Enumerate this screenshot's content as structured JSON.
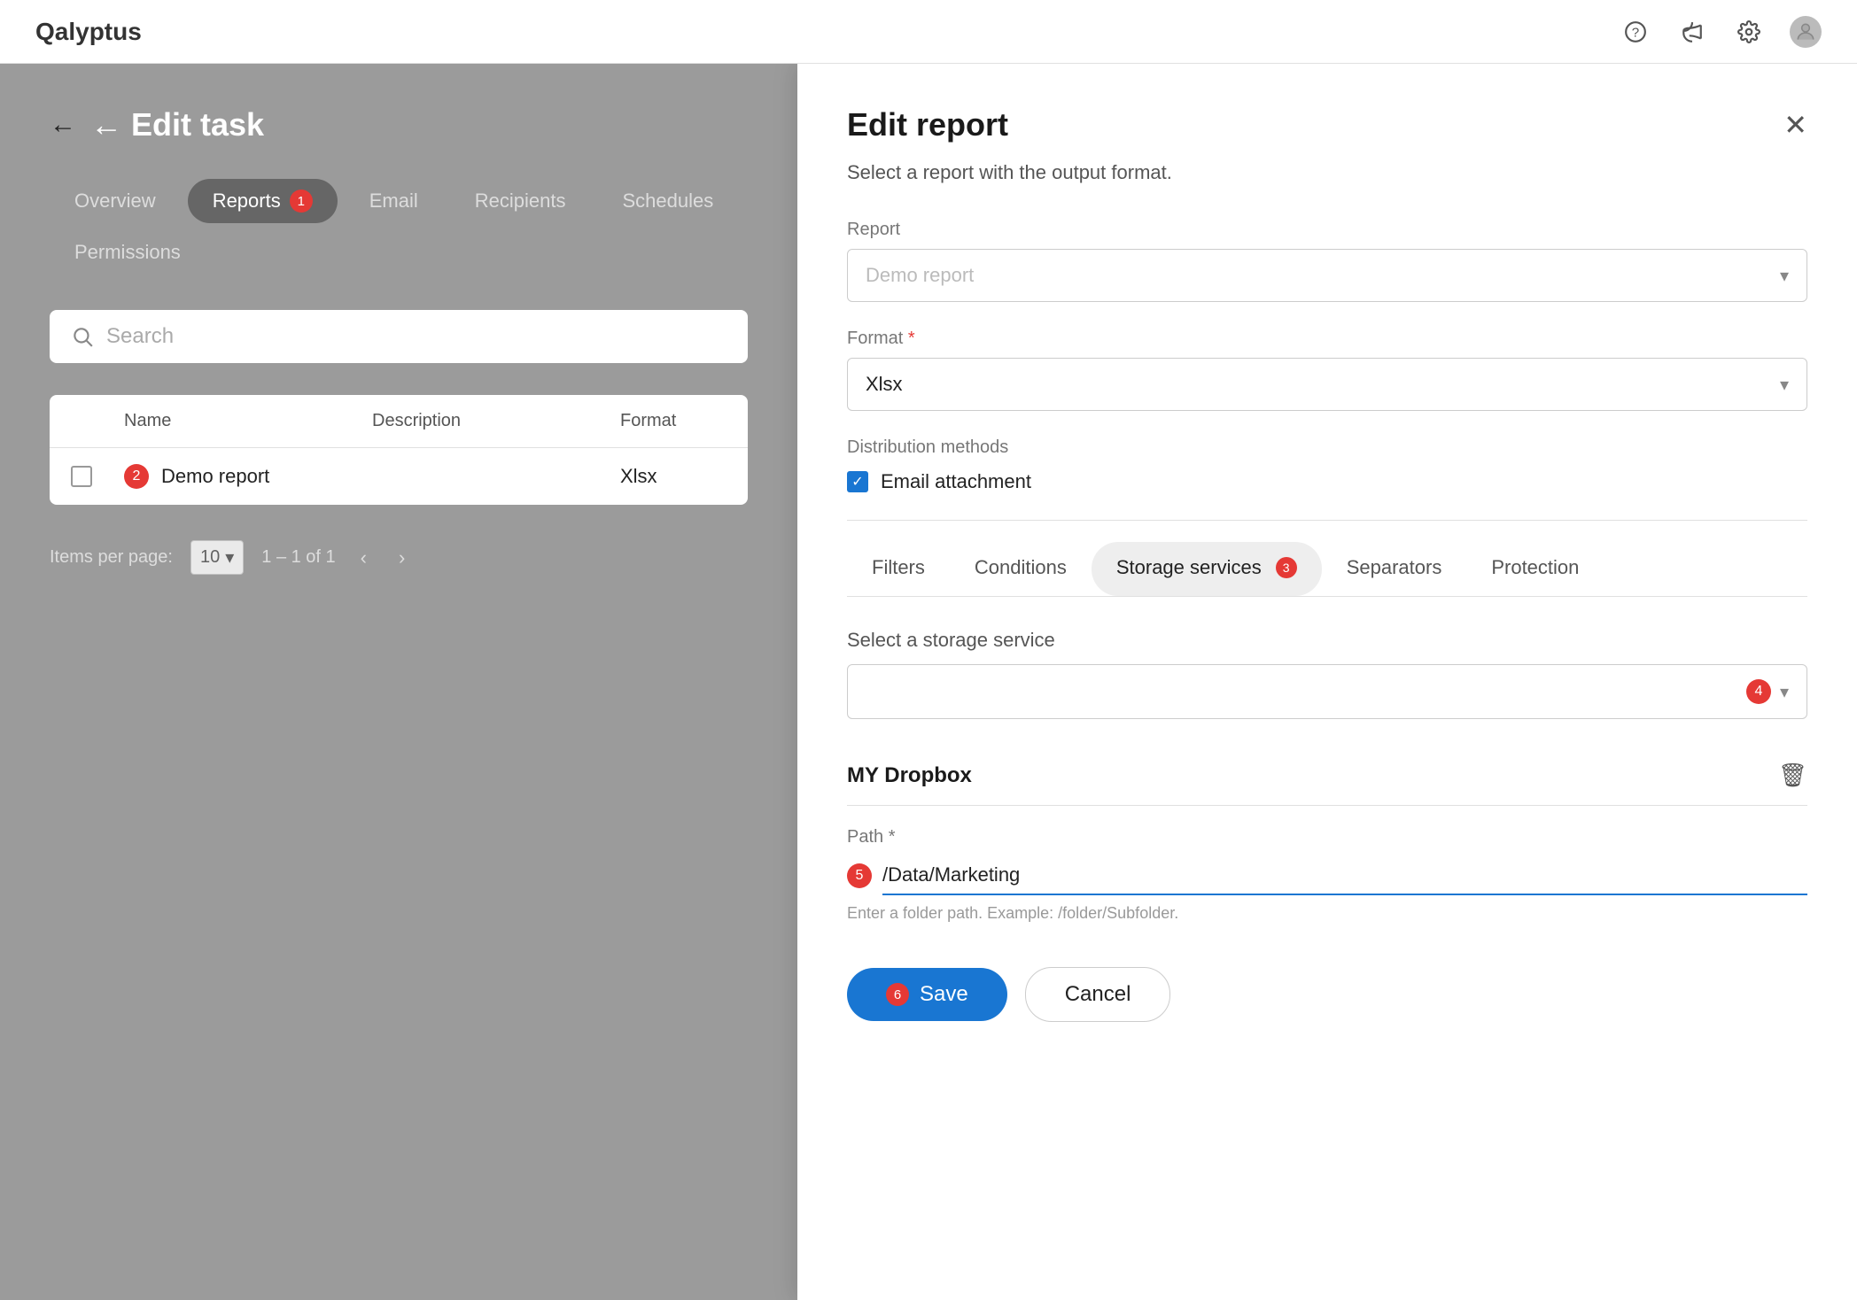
{
  "app": {
    "brand": "Qalyptus"
  },
  "topnav": {
    "help_icon": "?",
    "megaphone_icon": "📣",
    "settings_icon": "⚙",
    "avatar_icon": "👤"
  },
  "left_panel": {
    "back_label": "← Edit task",
    "tabs": [
      {
        "id": "overview",
        "label": "Overview",
        "active": false,
        "badge": null
      },
      {
        "id": "reports",
        "label": "Reports",
        "active": true,
        "badge": "1"
      },
      {
        "id": "email",
        "label": "Email",
        "active": false,
        "badge": null
      },
      {
        "id": "recipients",
        "label": "Recipients",
        "active": false,
        "badge": null
      },
      {
        "id": "schedules",
        "label": "Schedules",
        "active": false,
        "badge": null
      },
      {
        "id": "permissions",
        "label": "Permissions",
        "active": false,
        "badge": null
      }
    ],
    "search_placeholder": "Search",
    "table": {
      "columns": [
        "",
        "Name",
        "Description",
        "Format"
      ],
      "rows": [
        {
          "badge": "2",
          "name": "Demo report",
          "description": "",
          "format": "Xlsx"
        }
      ]
    },
    "pagination": {
      "items_label": "Items per page:",
      "per_page": "10",
      "page_info": "1 – 1 of 1"
    }
  },
  "right_panel": {
    "title": "Edit report",
    "subtitle": "Select a report with the output format.",
    "report_label": "Report",
    "report_placeholder": "Demo report",
    "format_label": "Format",
    "format_value": "Xlsx",
    "distribution_label": "Distribution methods",
    "email_attachment_label": "Email attachment",
    "filter_tabs": [
      {
        "id": "filters",
        "label": "Filters",
        "active": false,
        "badge": null
      },
      {
        "id": "conditions",
        "label": "Conditions",
        "active": false,
        "badge": null
      },
      {
        "id": "storage",
        "label": "Storage services",
        "active": true,
        "badge": "3"
      },
      {
        "id": "separators",
        "label": "Separators",
        "active": false,
        "badge": null
      },
      {
        "id": "protection",
        "label": "Protection",
        "active": false,
        "badge": null
      }
    ],
    "storage_select_label": "Select a storage service",
    "storage_select_badge": "4",
    "storage_item_name": "MY Dropbox",
    "path_label": "Path",
    "path_value": "/Data/Marketing",
    "path_hint": "Enter a folder path. Example: /folder/Subfolder.",
    "path_badge": "5",
    "save_label": "Save",
    "save_badge": "6",
    "cancel_label": "Cancel"
  }
}
